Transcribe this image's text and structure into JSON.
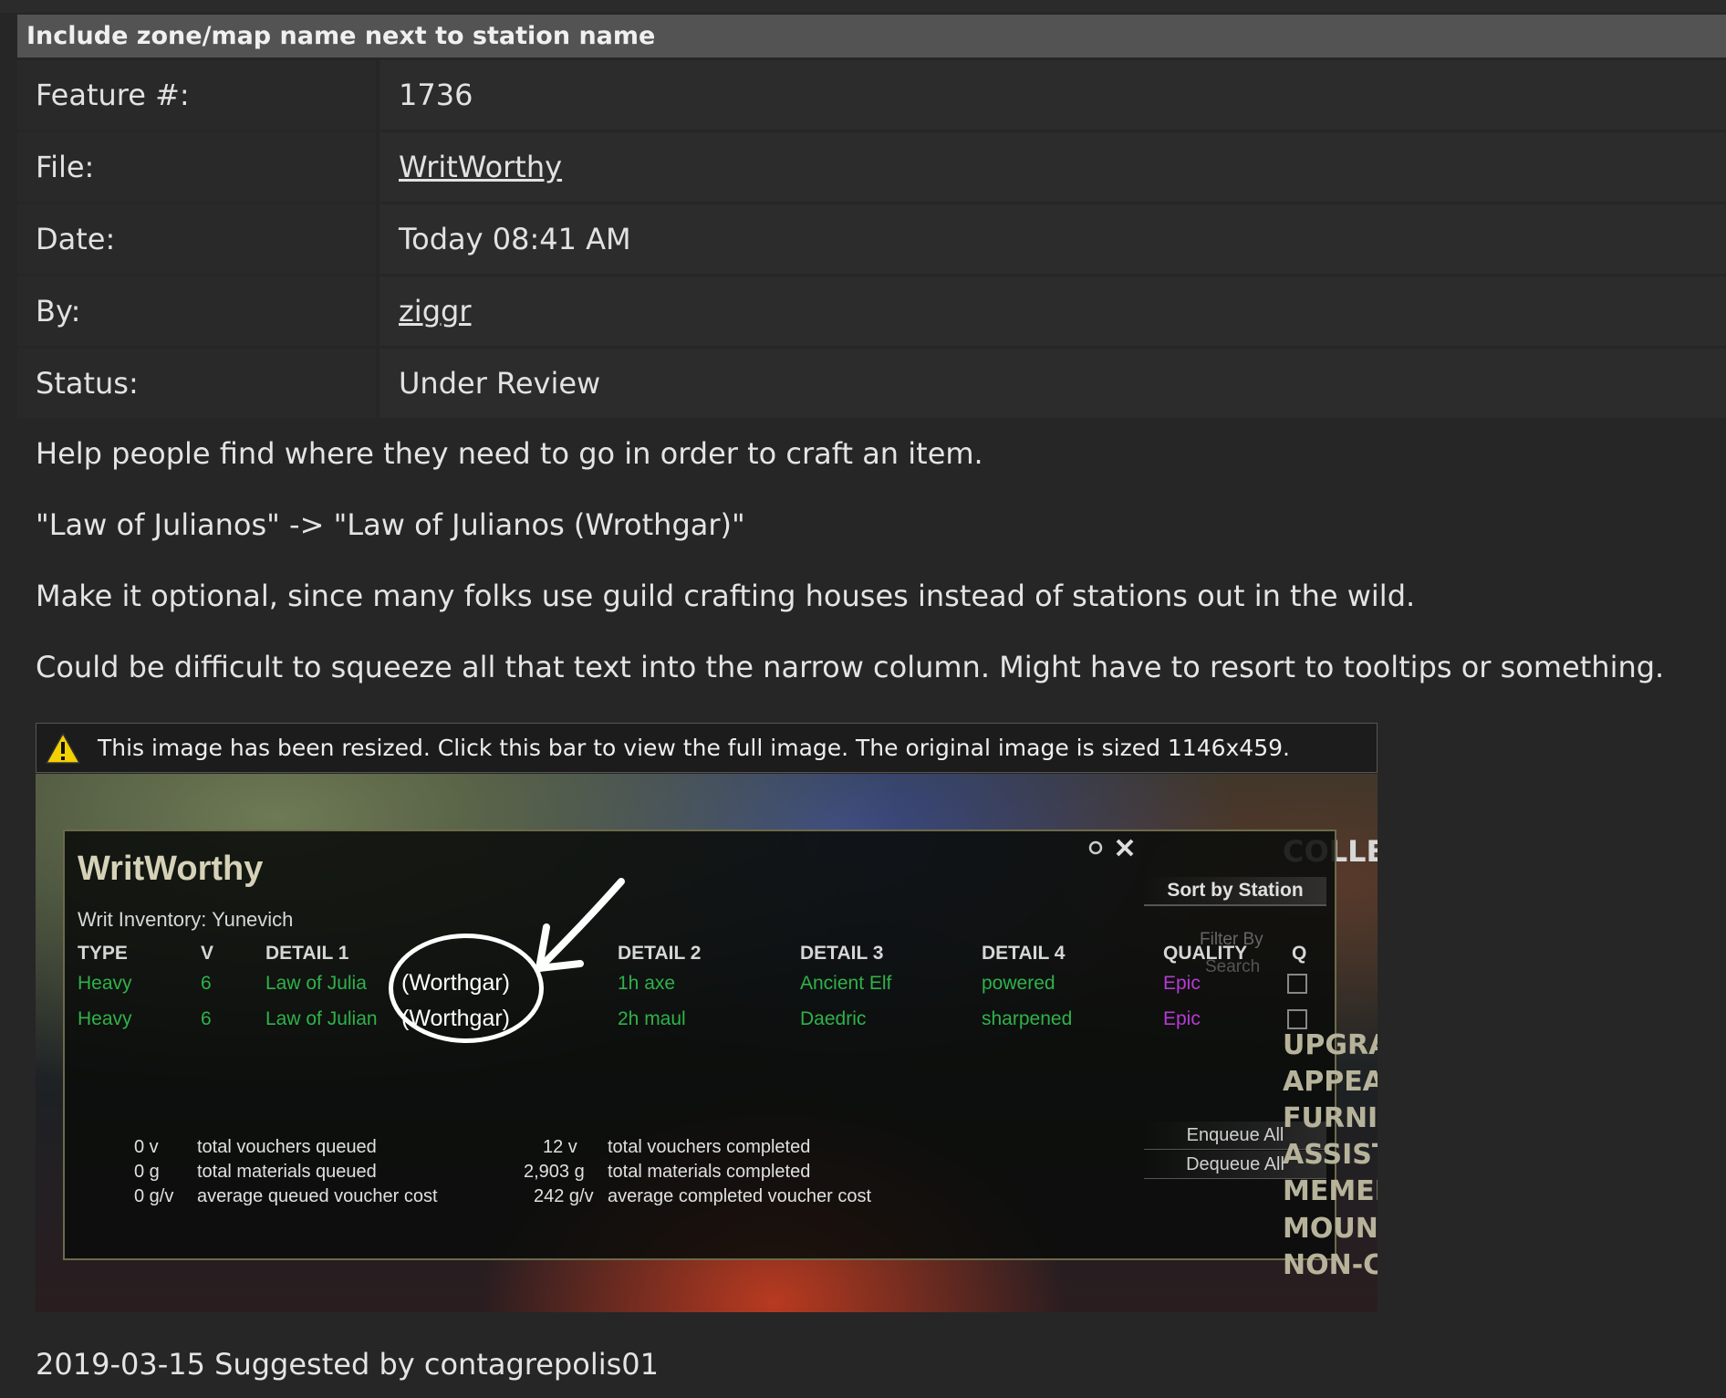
{
  "header": {
    "title": "Include zone/map name next to station name"
  },
  "details": {
    "feature_label": "Feature #:",
    "feature_value": "1736",
    "file_label": "File:",
    "file_value": "WritWorthy",
    "date_label": "Date:",
    "date_value": "Today 08:41 AM",
    "by_label": "By:",
    "by_value": "ziggr",
    "status_label": "Status:",
    "status_value": "Under Review"
  },
  "description": {
    "p1": "Help people find where they need to go in order to craft an item.",
    "p2": "\"Law of Julianos\" -> \"Law of Julianos (Wrothgar)\"",
    "p3": "Make it optional, since many folks use guild crafting houses instead of stations out in the wild.",
    "p4": "Could be difficult to squeeze all that text into the narrow column. Might have to resort to tooltips or something."
  },
  "resize_notice": "This image has been resized. Click this bar to view the full image. The original image is sized 1146x459.",
  "screenshot": {
    "window_title": "WritWorthy",
    "inventory": "Writ Inventory: Yunevich",
    "columns": {
      "type": "TYPE",
      "v": "V",
      "detail1": "DETAIL 1",
      "detail2": "DETAIL 2",
      "detail3": "DETAIL 3",
      "detail4": "DETAIL 4",
      "quality": "QUALITY",
      "q": "Q"
    },
    "rows": [
      {
        "type": "Heavy",
        "v": "6",
        "detail1": "Law of Julia",
        "zone": "(Worthgar)",
        "detail2": "1h axe",
        "detail3": "Ancient Elf",
        "detail4": "powered",
        "quality": "Epic"
      },
      {
        "type": "Heavy",
        "v": "6",
        "detail1": "Law of Julian",
        "zone": "(Worthgar)",
        "detail2": "2h maul",
        "detail3": "Daedric",
        "detail4": "sharpened",
        "quality": "Epic"
      }
    ],
    "sort_button": "Sort by Station",
    "enqueue_button": "Enqueue All",
    "dequeue_button": "Dequeue All",
    "totals": {
      "q1_val": "0 v",
      "q1_label": "total vouchers queued",
      "q2_val": "0 g",
      "q2_label": "total materials queued",
      "q3_val": "0 g/v",
      "q3_label": "average queued voucher cost",
      "c1_val": "12 v",
      "c1_label": "total vouchers completed",
      "c2_val": "2,903 g",
      "c2_label": "total materials completed",
      "c3_val": "242 g/v",
      "c3_label": "average completed voucher cost"
    },
    "side_menu": [
      "UPGRADE",
      "APPEARAN",
      "FURNISHIN",
      "ASSISTANT",
      "MEMENTOS",
      "MOUNTS",
      "NON-COME"
    ],
    "filter_text": "Filter By",
    "search_text": "Search",
    "collections_text": "COLLECTIONS"
  },
  "footer": "2019-03-15 Suggested by contagrepolis01"
}
